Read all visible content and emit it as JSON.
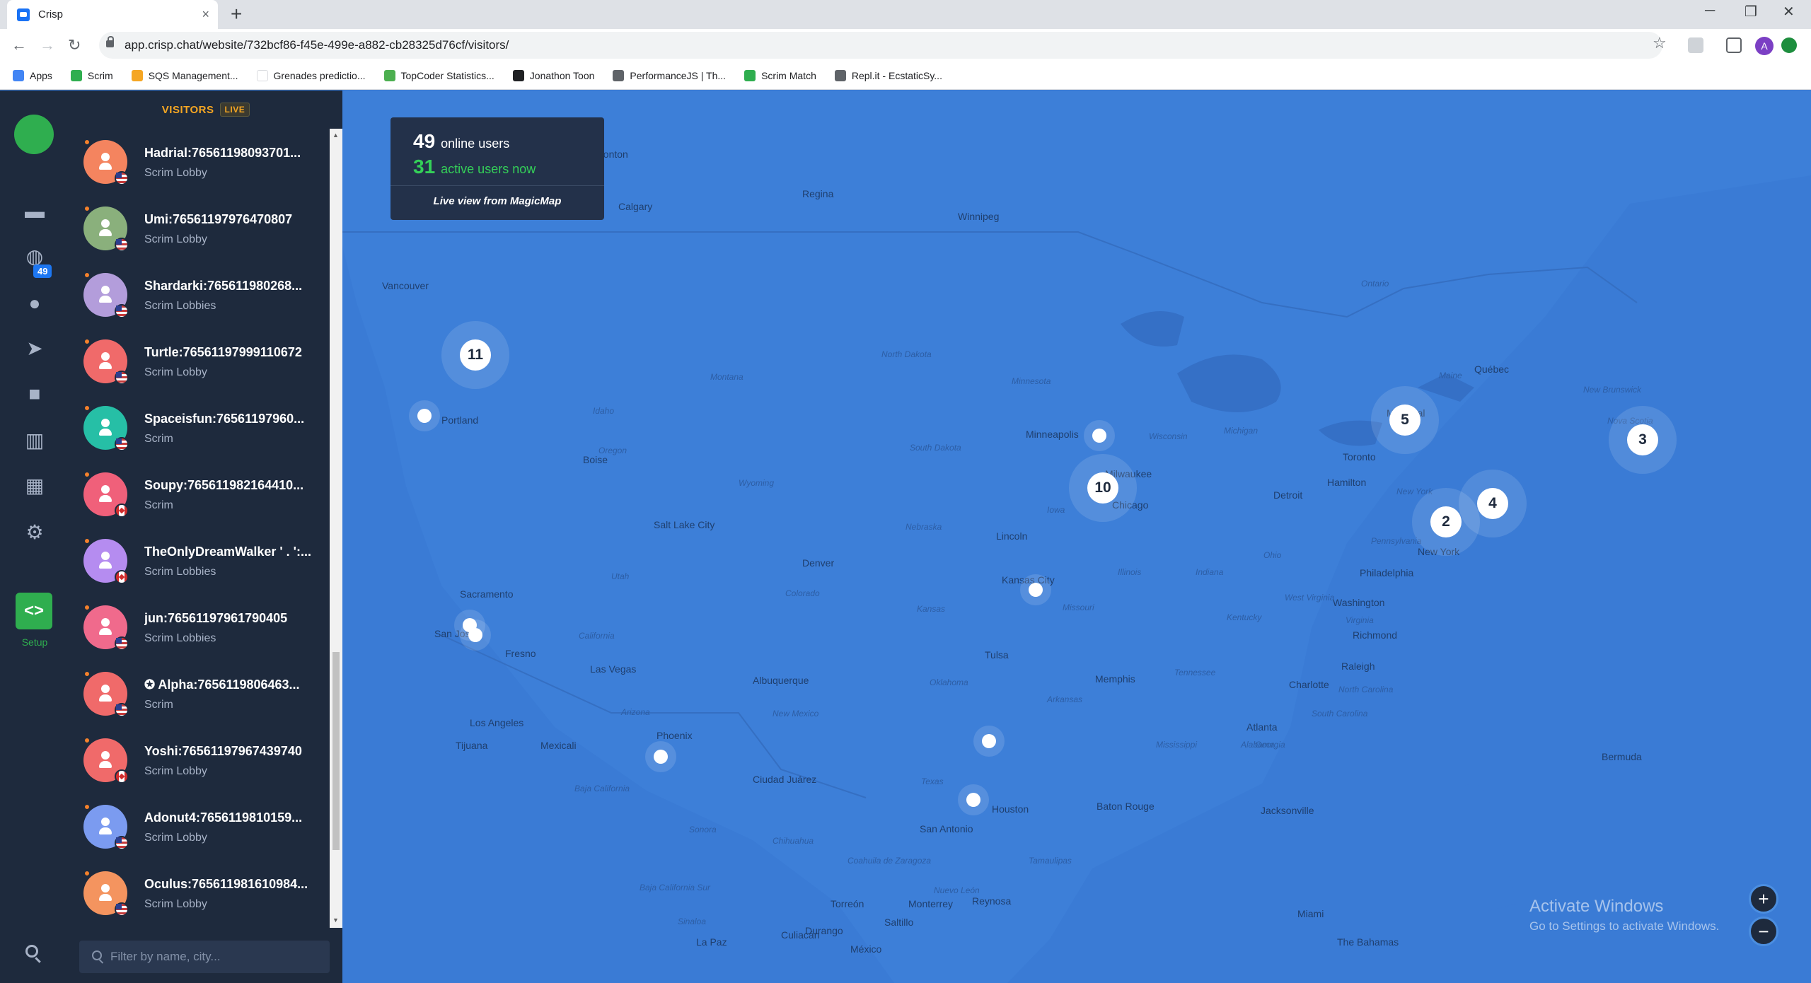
{
  "browser": {
    "tab_title": "Crisp",
    "tab_close": "×",
    "new_tab": "+",
    "url": "app.crisp.chat/website/732bcf86-f45e-499e-a882-cb28325d76cf/visitors/",
    "window_controls": [
      "─",
      "❐",
      "✕"
    ],
    "profile_initial": "A",
    "bookmarks": [
      {
        "label": "Apps",
        "icon": "apps-grid-icon",
        "color": "#4285f4"
      },
      {
        "label": "Scrim",
        "icon": "scrim-icon",
        "color": "#2fae4f"
      },
      {
        "label": "SQS Management...",
        "icon": "sqs-icon",
        "color": "#f5a623"
      },
      {
        "label": "Grenades predictio...",
        "icon": "blank-icon",
        "color": "#ffffff"
      },
      {
        "label": "TopCoder Statistics...",
        "icon": "topcoder-icon",
        "color": "#4caf50"
      },
      {
        "label": "Jonathon Toon",
        "icon": "flag-icon",
        "color": "#202124"
      },
      {
        "label": "PerformanceJS | Th...",
        "icon": "globe-icon",
        "color": "#5f6368"
      },
      {
        "label": "Scrim Match",
        "icon": "scrim-icon",
        "color": "#2fae4f"
      },
      {
        "label": "Repl.it - EcstaticSy...",
        "icon": "replit-icon",
        "color": "#5f6368"
      }
    ]
  },
  "rail": {
    "badge_count": "49",
    "setup_label": "Setup",
    "setup_glyph": "<>",
    "items": [
      "chat-icon",
      "globe-icon",
      "user-icon",
      "send-icon",
      "folder-icon",
      "chart-icon",
      "plugins-icon",
      "gear-icon"
    ]
  },
  "visitors_panel": {
    "title": "VISITORS",
    "live_badge": "LIVE",
    "filter_placeholder": "Filter by name, city...",
    "visitors": [
      {
        "name": "Hadrial:76561198093701...",
        "location": "Scrim Lobby",
        "flag": "us",
        "color": "#f4845f"
      },
      {
        "name": "Umi:76561197976470807",
        "location": "Scrim Lobby",
        "flag": "us",
        "color": "#8ab07c"
      },
      {
        "name": "Shardarki:765611980268...",
        "location": "Scrim Lobbies",
        "flag": "us",
        "color": "#b39ddb"
      },
      {
        "name": "Turtle:76561197999110672",
        "location": "Scrim Lobby",
        "flag": "us",
        "color": "#f06a6a"
      },
      {
        "name": "Spaceisfun:76561197960...",
        "location": "Scrim",
        "flag": "us",
        "color": "#26bfa6"
      },
      {
        "name": "Soupy:765611982164410...",
        "location": "Scrim",
        "flag": "ca",
        "color": "#f0607a"
      },
      {
        "name": "TheOnlyDreamWalker ' . ':...",
        "location": "Scrim Lobbies",
        "flag": "ca",
        "color": "#b58cf0"
      },
      {
        "name": "jun:76561197961790405",
        "location": "Scrim Lobbies",
        "flag": "us",
        "color": "#f06a8c"
      },
      {
        "name": "✪ Alpha:7656119806463...",
        "location": "Scrim",
        "flag": "us",
        "color": "#f06a6a"
      },
      {
        "name": "Yoshi:76561197967439740",
        "location": "Scrim Lobby",
        "flag": "ca",
        "color": "#f06a6a"
      },
      {
        "name": "Adonut4:7656119810159...",
        "location": "Scrim Lobby",
        "flag": "us",
        "color": "#7b9bf0"
      },
      {
        "name": "Oculus:765611981610984...",
        "location": "Scrim Lobby",
        "flag": "us",
        "color": "#f4945f"
      }
    ]
  },
  "map": {
    "stats": {
      "online_count": "49",
      "online_label": "online users",
      "active_count": "31",
      "active_label": "active users now",
      "footer": "Live view from MagicMap"
    },
    "clusters": [
      {
        "id": "cluster-pacific-northwest",
        "count": "11"
      },
      {
        "id": "cluster-chicago",
        "count": "10"
      },
      {
        "id": "cluster-montreal",
        "count": "5"
      },
      {
        "id": "cluster-nova-scotia",
        "count": "3"
      },
      {
        "id": "cluster-boston",
        "count": "4"
      },
      {
        "id": "cluster-new-york",
        "count": "2"
      }
    ],
    "cities": [
      "Edmonton",
      "Calgary",
      "Regina",
      "Winnipeg",
      "Vancouver",
      "Portland",
      "Boise",
      "Salt Lake City",
      "Denver",
      "Sacramento",
      "San Jose",
      "Fresno",
      "Las Vegas",
      "Los Angeles",
      "Tijuana",
      "Mexicali",
      "Phoenix",
      "Albuquerque",
      "Ciudad Juárez",
      "Minneapolis",
      "Milwaukee",
      "Chicago",
      "Detroit",
      "Toronto",
      "Hamilton",
      "Montréal",
      "Québec",
      "Lincoln",
      "Kansas City",
      "Tulsa",
      "Memphis",
      "Atlanta",
      "Charlotte",
      "Raleigh",
      "Richmond",
      "Washington",
      "Philadelphia",
      "New York",
      "Houston",
      "San Antonio",
      "Baton Rouge",
      "Jacksonville",
      "Miami",
      "Torreón",
      "Monterrey",
      "Saltillo",
      "Reynosa",
      "Culiacán",
      "La Paz",
      "Durango",
      "México",
      "Bermuda",
      "The Bahamas"
    ],
    "states": [
      "Montana",
      "North Dakota",
      "South Dakota",
      "Minnesota",
      "Idaho",
      "Oregon",
      "Wyoming",
      "Nebraska",
      "Iowa",
      "Utah",
      "Colorado",
      "California",
      "Arizona",
      "New Mexico",
      "Oklahoma",
      "Texas",
      "Illinois",
      "Indiana",
      "Ohio",
      "Missouri",
      "Arkansas",
      "Tennessee",
      "Kentucky",
      "Mississippi",
      "Alabama",
      "Georgia",
      "South Carolina",
      "North Carolina",
      "Virginia",
      "West Virginia",
      "Pennsylvania",
      "New York",
      "Michigan",
      "Ontario",
      "Maine",
      "New Brunswick",
      "Nova Scotia",
      "Sonora",
      "Chihuahua",
      "Coahuila de Zaragoza",
      "Nuevo León",
      "Tamaulipas",
      "Sinaloa",
      "Baja California",
      "Baja California Sur",
      "Wisconsin",
      "Kansas"
    ],
    "zoom_in": "+",
    "zoom_out": "−",
    "watermark_title": "Activate Windows",
    "watermark_sub": "Go to Settings to activate Windows."
  }
}
